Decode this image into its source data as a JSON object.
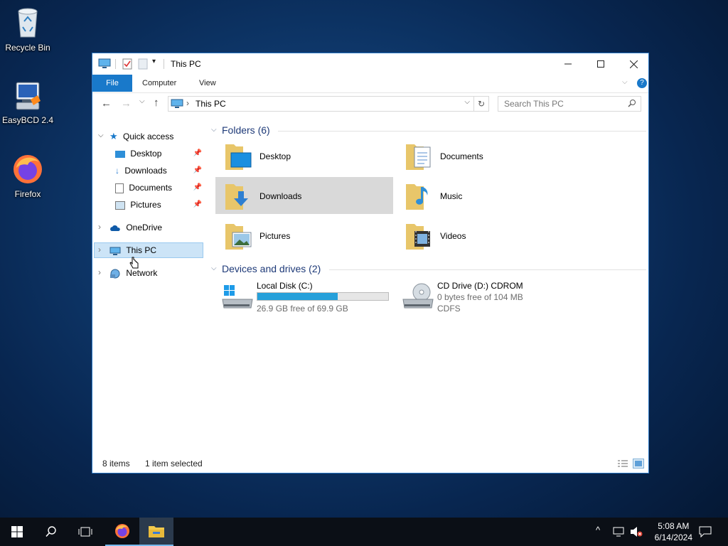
{
  "desktop": {
    "icons": [
      {
        "label": "Recycle Bin",
        "icon": "recycle-bin-icon"
      },
      {
        "label": "EasyBCD 2.4",
        "icon": "easybcd-icon"
      },
      {
        "label": "Firefox",
        "icon": "firefox-icon"
      }
    ]
  },
  "window": {
    "title": "This PC",
    "ribbon_tabs": [
      "File",
      "Computer",
      "View"
    ],
    "address": "This PC",
    "search_placeholder": "Search This PC",
    "nav": {
      "quick_access": "Quick access",
      "quick_items": [
        "Desktop",
        "Downloads",
        "Documents",
        "Pictures"
      ],
      "onedrive": "OneDrive",
      "this_pc": "This PC",
      "network": "Network"
    },
    "folders_header": "Folders (6)",
    "folders": [
      "Desktop",
      "Documents",
      "Downloads",
      "Music",
      "Pictures",
      "Videos"
    ],
    "devices_header": "Devices and drives (2)",
    "drives": [
      {
        "name": "Local Disk (C:)",
        "free_text": "26.9 GB free of 69.9 GB",
        "used_fraction": 0.615
      },
      {
        "name": "CD Drive (D:) CDROM",
        "free_text": "0 bytes free of 104 MB",
        "fs": "CDFS"
      }
    ],
    "status": {
      "items": "8 items",
      "selected": "1 item selected"
    }
  },
  "taskbar": {
    "time": "5:08 AM",
    "date": "6/14/2024"
  },
  "colors": {
    "accent": "#1979ca",
    "selection": "#cce4f7",
    "drive_bar": "#26a0da",
    "hover_tile": "#d9d9d9"
  }
}
